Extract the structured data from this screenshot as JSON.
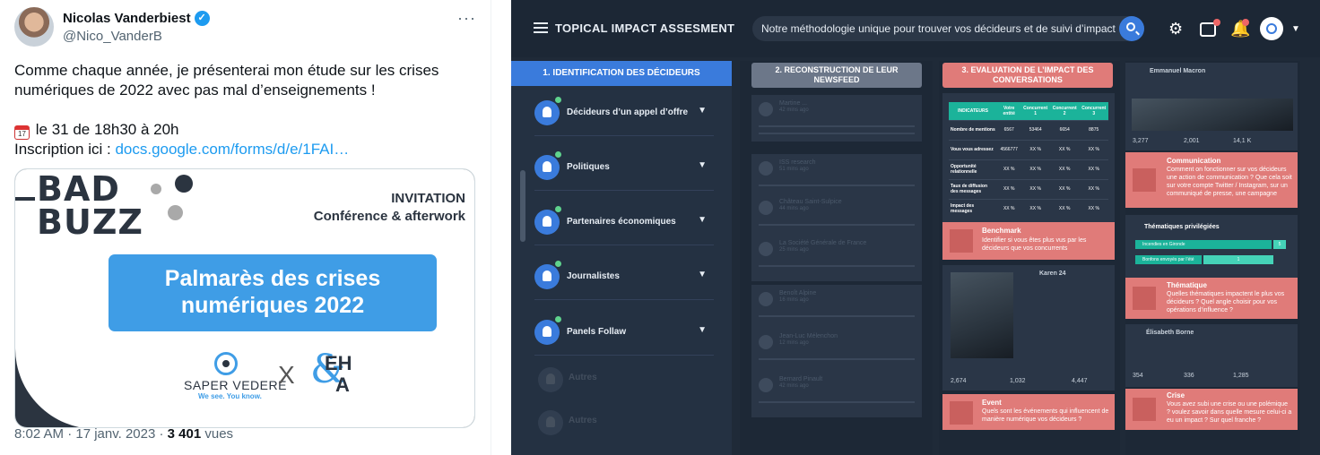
{
  "tweet": {
    "name": "Nicolas Vanderbiest",
    "handle": "@Nico_VanderB",
    "more": "···",
    "text1": "Comme chaque année, je présenterai mon étude sur les crises numériques de 2022 avec pas mal d’enseignements !",
    "date_line": "le 31 de 18h30 à 20h",
    "calendar_day": "17",
    "inscription_label": "Inscription ici : ",
    "link": "docs.google.com/forms/d/e/1FAI…",
    "card": {
      "logo_line1": "BAD",
      "logo_line2": "BUZZ",
      "invitation": "INVITATION",
      "subtitle": "Conférence & afterwork",
      "headline": "Palmarès des crises numériques 2022",
      "saper_name": "SAPER VEDERE",
      "saper_tag": "We see. You know.",
      "cross": "X",
      "eha_e": "EH",
      "eha_a": "A"
    },
    "timestamp": "8:02 AM · 17 janv. 2023 · ",
    "views_count": "3 401",
    "views_label": " vues"
  },
  "dash": {
    "title": "TOPICAL IMPACT ASSESMENT",
    "search_placeholder": "Notre méthodologie unique pour trouver vos décideurs et de suivi d’impact",
    "col1_head": "1. IDENTIFICATION DES DÉCIDEURS",
    "nav": [
      {
        "label": "Décideurs d’un appel d’offre"
      },
      {
        "label": "Politiques"
      },
      {
        "label": "Partenaires économiques"
      },
      {
        "label": "Journalistes"
      },
      {
        "label": "Panels Follaw"
      }
    ],
    "nav_faded": [
      "Autres",
      "Autres"
    ],
    "col2_head": "2. RECONSTRUCTION DE LEUR NEWSFEED",
    "feed": [
      {
        "name": "Martine ...",
        "time": "42 mins ago"
      },
      {
        "name": "ISS research",
        "time": "51 mins ago"
      },
      {
        "name": "Château Saint-Sulpice",
        "time": "44 mins ago"
      },
      {
        "name": "La Société Générale de France",
        "time": "25 mins ago"
      },
      {
        "name": "Benoît Alpine",
        "time": "16 mins ago"
      },
      {
        "name": "Jean-Luc Mélenchon",
        "time": "12 mins ago"
      },
      {
        "name": "Bernard Pinault",
        "time": "42 mins ago"
      }
    ],
    "col3_head": "3. EVALUATION DE L’IMPACT DES CONVERSATIONS",
    "table": {
      "headers": [
        "INDICATEURS",
        "Votre entité",
        "Concurrent 1",
        "Concurrent 2",
        "Concurrent 3"
      ],
      "rows": [
        [
          "Nombre de mentions",
          "6567",
          "53464",
          "6654",
          "8875"
        ],
        [
          "Vous vous adressez",
          "4566777",
          "XX %",
          "XX %",
          "XX %"
        ],
        [
          "Opportunité relationnelle",
          "XX %",
          "XX %",
          "XX %",
          "XX %"
        ],
        [
          "Taux de diffusion des messages",
          "XX %",
          "XX %",
          "XX %",
          "XX %"
        ],
        [
          "Impact des messages",
          "XX %",
          "XX %",
          "XX %",
          "XX %"
        ]
      ]
    },
    "benchmark": {
      "title": "Benchmark",
      "text": "Identifier si vous êtes plus vus par les décideurs que vos concurrents"
    },
    "post_stats": {
      "comments": "2,674",
      "retweets": "1,032",
      "likes": "4,447"
    },
    "event": {
      "title": "Event",
      "text": "Quels sont les événements qui influencent de manière numérique vos décideurs ?"
    },
    "macron_stats": {
      "comments": "3,277",
      "retweets": "2,001",
      "likes": "14,1 K"
    },
    "communication": {
      "title": "Communication",
      "text": "Comment on fonctionner sur vos décideurs une action de communication ? Que cela soit sur votre compte Twitter / Instagram, sur un communiqué de presse, une campagne"
    },
    "themes": {
      "title": "Thématiques privilégiées",
      "bar1": "Incendies en Gironde",
      "val1": "5",
      "bar2": "Bonfons envoyés par l’été",
      "val2": "1"
    },
    "thematique": {
      "title": "Thématique",
      "text": "Quelles thématiques impactent le plus vos décideurs ? Quel angle choisir pour vos opérations d’influence ?"
    },
    "borne_stats": {
      "comments": "354",
      "retweets": "336",
      "likes": "1,285"
    },
    "crise": {
      "title": "Crise",
      "text": "Vous avez subi une crise ou une polémique ? voulez savoir dans quelle mesure celui-ci a eu un impact ? Sur quel franche ?"
    },
    "post_authors": {
      "a1": "Emmanuel Macron",
      "a2": "Karen 24",
      "a3": "Élisabeth Borne"
    }
  }
}
